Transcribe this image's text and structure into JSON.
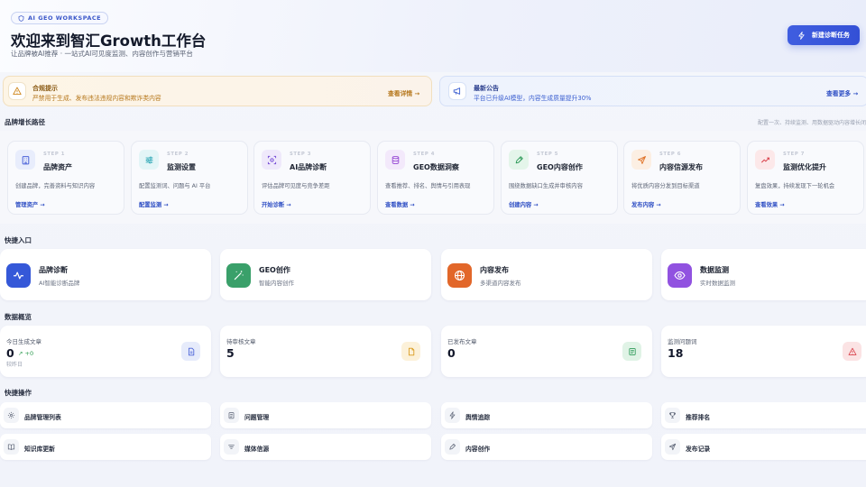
{
  "header": {
    "badge": "AI GEO WORKSPACE",
    "title": "欢迎来到智汇Growth工作台",
    "subtitle": "让品牌被AI推荐 · 一站式AI可见度监测、内容创作与营销平台",
    "new_task_label": "新建诊断任务"
  },
  "notices": [
    {
      "title": "合规提示",
      "text": "严禁用于生成、发布违法违规内容和欺诈类内容",
      "link": "查看详情 →"
    },
    {
      "title": "最新公告",
      "text": "平台已升级AI模型，内容生成质量提升30%",
      "link": "查看更多 →"
    }
  ],
  "growth_path": {
    "title": "品牌增长路径",
    "note": "配置一次、持续监测、用数据驱动内容增长闭",
    "steps": [
      {
        "step": "STEP 1",
        "title": "品牌资产",
        "desc": "创建品牌，完善资料与知识内容",
        "link": "管理资产 →",
        "icon": "building-icon",
        "color": "#4a62d8",
        "bg": "#e8edfc"
      },
      {
        "step": "STEP 2",
        "title": "监测设置",
        "desc": "配置监测词、问题与 AI 平台",
        "link": "配置监测 →",
        "icon": "sliders-icon",
        "color": "#2ba6b5",
        "bg": "#e3f5f7"
      },
      {
        "step": "STEP 3",
        "title": "AI品牌诊断",
        "desc": "评估品牌可见度与竞争差距",
        "link": "开始诊断 →",
        "icon": "scan-icon",
        "color": "#7a52d8",
        "bg": "#efe9fb"
      },
      {
        "step": "STEP 4",
        "title": "GEO数据洞察",
        "desc": "查看推荐、排名、舆情与引用表现",
        "link": "查看数据 →",
        "icon": "database-icon",
        "color": "#9b4fd6",
        "bg": "#f3e9fb"
      },
      {
        "step": "STEP 5",
        "title": "GEO内容创作",
        "desc": "围绕数据缺口生成并审核内容",
        "link": "创建内容 →",
        "icon": "pen-icon",
        "color": "#2f9b5a",
        "bg": "#e4f5ea"
      },
      {
        "step": "STEP 6",
        "title": "内容信源发布",
        "desc": "将优质内容分发到目标渠道",
        "link": "发布内容 →",
        "icon": "send-icon",
        "color": "#e0742a",
        "bg": "#fcefe3"
      },
      {
        "step": "STEP 7",
        "title": "监测优化提升",
        "desc": "复盘效果，持续发现下一轮机会",
        "link": "查看效果 →",
        "icon": "trend-icon",
        "color": "#d9434c",
        "bg": "#fce8e9"
      }
    ]
  },
  "quick_entry": {
    "title": "快捷入口",
    "items": [
      {
        "title": "品牌诊断",
        "sub": "AI智能诊断品牌",
        "icon": "pulse-icon",
        "color": "#3558d8"
      },
      {
        "title": "GEO创作",
        "sub": "智能内容创作",
        "icon": "magic-wand-icon",
        "color": "#3aa06a"
      },
      {
        "title": "内容发布",
        "sub": "多渠道内容发布",
        "icon": "globe-icon",
        "color": "#e2672a"
      },
      {
        "title": "数据监测",
        "sub": "实时数据监测",
        "icon": "eye-icon",
        "color": "#9152e0"
      }
    ]
  },
  "overview": {
    "title": "数据概览",
    "stats": [
      {
        "label": "今日生成文章",
        "value": "0",
        "delta": "↗ +0",
        "sub": "较昨日",
        "icon": "document-icon",
        "color": "#4a62d8",
        "bg": "#e6ebfb"
      },
      {
        "label": "待审核文章",
        "value": "5",
        "icon": "file-pending-icon",
        "color": "#d99a1c",
        "bg": "#fcf1d9"
      },
      {
        "label": "已发布文章",
        "value": "0",
        "icon": "newspaper-icon",
        "color": "#2f9b5a",
        "bg": "#e0f3e6"
      },
      {
        "label": "监测问题词",
        "value": "18",
        "icon": "alert-icon",
        "color": "#d9434c",
        "bg": "#fbe3e4"
      }
    ]
  },
  "quick_actions": {
    "title": "快捷操作",
    "items": [
      {
        "label": "品牌管理列表",
        "icon": "gear-icon"
      },
      {
        "label": "问题管理",
        "icon": "clipboard-icon"
      },
      {
        "label": "舆情追踪",
        "icon": "lightning-icon"
      },
      {
        "label": "推荐排名",
        "icon": "trophy-icon"
      },
      {
        "label": "知识库更新",
        "icon": "book-icon"
      },
      {
        "label": "媒体信源",
        "icon": "filter-icon"
      },
      {
        "label": "内容创作",
        "icon": "pen-icon"
      },
      {
        "label": "发布记录",
        "icon": "send-icon"
      }
    ]
  }
}
